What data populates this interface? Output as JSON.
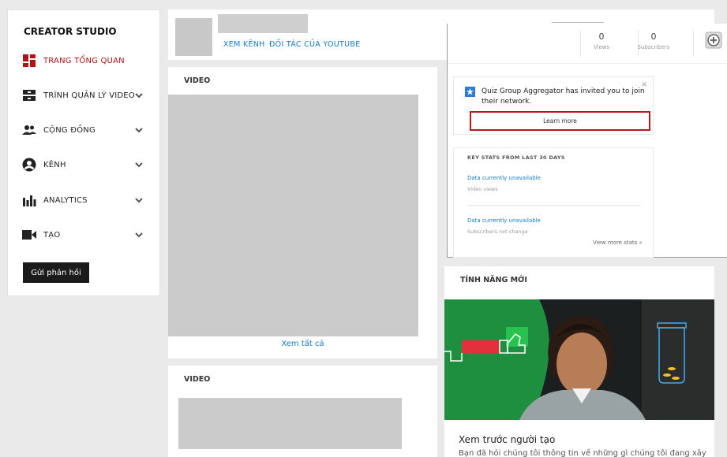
{
  "sidebar": {
    "title": "CREATOR STUDIO",
    "items": [
      {
        "label": "TRANG TỔNG QUAN",
        "icon": "dashboard-icon",
        "active": true
      },
      {
        "label": "TRÌNH QUẢN LÝ VIDEO",
        "icon": "video-manager-icon"
      },
      {
        "label": "CỘNG ĐỒNG",
        "icon": "community-icon"
      },
      {
        "label": "KÊNH",
        "icon": "channel-icon"
      },
      {
        "label": "ANALYTICS",
        "icon": "analytics-icon"
      },
      {
        "label": "TẠO",
        "icon": "create-icon"
      }
    ],
    "feedback_label": "Gửi phản hồi"
  },
  "channel": {
    "view_channel": "XEM KÊNH",
    "partner": "ĐỐI TÁC CỦA YOUTUBE",
    "views_value": "0",
    "views_label": "Views",
    "subs_value": "0",
    "subs_label": "Subscribers"
  },
  "video_card_1": {
    "header": "VIDEO",
    "see_all": "Xem tất cả"
  },
  "video_card_2": {
    "header": "VIDEO"
  },
  "invite": {
    "text": "Quiz Group Aggregator has invited you to join their network.",
    "close": "×",
    "button": "Learn more"
  },
  "stats": {
    "header": "KEY STATS FROM LAST 30 DAYS",
    "items": [
      {
        "link": "Data currently unavailable",
        "sub": "Video views"
      },
      {
        "link": "Data currently unavailable",
        "sub": "Subscribers net change"
      }
    ],
    "more": "View more stats »"
  },
  "feature": {
    "header": "TÍNH NĂNG MỚI",
    "title": "Xem trước người tạo",
    "desc": "Bạn đã hỏi chúng tôi thông tin về những gì chúng tôi đang xây"
  },
  "colors": {
    "accent_red": "#b31217",
    "link_blue": "#167ac6"
  }
}
